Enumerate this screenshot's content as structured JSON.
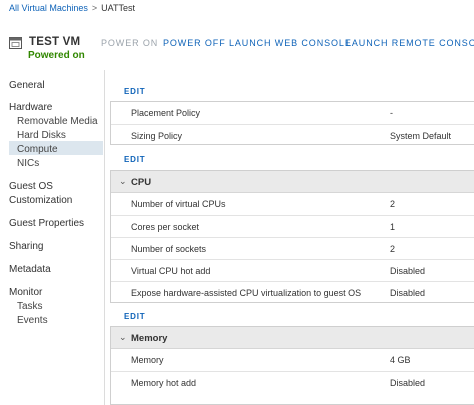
{
  "breadcrumb": {
    "root": "All Virtual Machines",
    "separator": ">",
    "current": "UATTest"
  },
  "vm": {
    "name": "TEST VM",
    "state": "Powered on",
    "state_color": "#318700"
  },
  "actions": {
    "power_on": "POWER ON",
    "power_off": "POWER OFF",
    "launch_web_console": "LAUNCH WEB CONSOLE",
    "launch_remote_console": "LAUNCH REMOTE CONSOLE"
  },
  "sidebar": {
    "general": "General",
    "hardware": "Hardware",
    "removable_media": "Removable Media",
    "hard_disks": "Hard Disks",
    "compute": "Compute",
    "nics": "NICs",
    "guest_os_customization_1": "Guest OS",
    "guest_os_customization_2": "Customization",
    "guest_properties": "Guest Properties",
    "sharing": "Sharing",
    "metadata": "Metadata",
    "monitor": "Monitor",
    "tasks": "Tasks",
    "events": "Events"
  },
  "edit_label": "EDIT",
  "policies": [
    {
      "key": "Placement Policy",
      "value": "-"
    },
    {
      "key": "Sizing Policy",
      "value": "System Default"
    }
  ],
  "cpu": {
    "title": "CPU",
    "rows": [
      {
        "key": "Number of virtual CPUs",
        "value": "2"
      },
      {
        "key": "Cores per socket",
        "value": "1"
      },
      {
        "key": "Number of sockets",
        "value": "2"
      },
      {
        "key": "Virtual CPU hot add",
        "value": "Disabled"
      },
      {
        "key": "Expose hardware-assisted CPU virtualization to guest OS",
        "value": "Disabled"
      }
    ]
  },
  "memory": {
    "title": "Memory",
    "rows": [
      {
        "key": "Memory",
        "value": "4 GB"
      },
      {
        "key": "Memory hot add",
        "value": "Disabled"
      }
    ]
  },
  "colors": {
    "link": "#0f63b8",
    "disabled_action": "#9ba3ab",
    "selected_nav": "#dce6ee",
    "section_header": "#eaeaea"
  }
}
